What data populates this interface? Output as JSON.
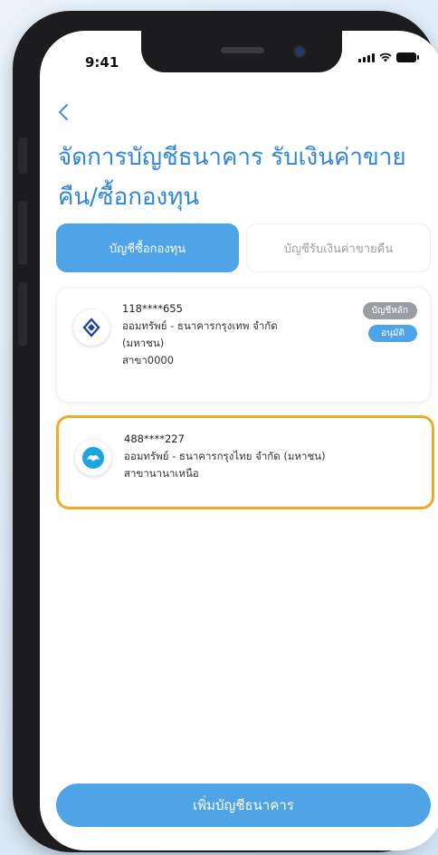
{
  "status_bar": {
    "time": "9:41"
  },
  "header": {
    "back_icon": "chevron-left-icon",
    "title_line1": "จัดการบัญชีธนาคาร รับเงินค่าขาย",
    "title_line2": "คืน/ซื้อกองทุน"
  },
  "tabs": [
    {
      "label": "บัญชีซื้อกองทุน",
      "active": true
    },
    {
      "label": "บัญชีรับเงินค่าขายคืน",
      "active": false
    }
  ],
  "accounts": [
    {
      "number": "118****655",
      "bank_line1": "ออมทรัพย์ - ธนาคารกรุงเทพ จำกัด",
      "bank_line2": "(มหาชน)",
      "branch": "สาขา0000",
      "badge_main": "บัญชีหลัก",
      "badge_status": "อนุมัติ",
      "logo_color": "#1e4598"
    },
    {
      "number": "488****227",
      "bank_line1": "ออมทรัพย์ - ธนาคารกรุงไทย จำกัด (มหาชน)",
      "branch": "สาขานานาเหนือ",
      "logo_color": "#1ba5e1",
      "highlight_color": "#f1a928"
    }
  ],
  "footer": {
    "add_button_label": "เพิ่มบัญชีธนาคาร"
  },
  "colors": {
    "accent": "#4ea4e6",
    "title": "#2f86da"
  }
}
